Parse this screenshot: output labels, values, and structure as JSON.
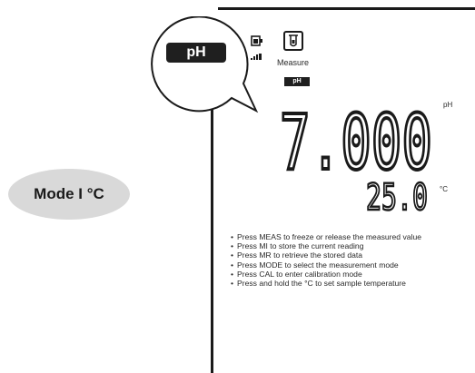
{
  "header": {
    "mode_pill": "pH",
    "measure_label": "Measure",
    "mode_badge": "pH"
  },
  "reading": {
    "ph_value": "7.000",
    "ph_unit": "pH",
    "temperature_value": "25.0",
    "temperature_unit": "°C"
  },
  "instructions": [
    "Press MEAS to freeze or release the measured value",
    "Press MI to store the current reading",
    "Press MR to retrieve the stored data",
    "Press MODE to select the measurement mode",
    "Press CAL to enter calibration mode",
    "Press and hold the °C to set sample temperature"
  ],
  "key": {
    "label": "Mode I °C"
  },
  "icons": {
    "battery": "battery-icon",
    "signal": "signal-strength-icon",
    "measure": "beaker-icon"
  },
  "colors": {
    "display_ink": "#1a1a1a",
    "key_background": "#d9d9d9"
  }
}
